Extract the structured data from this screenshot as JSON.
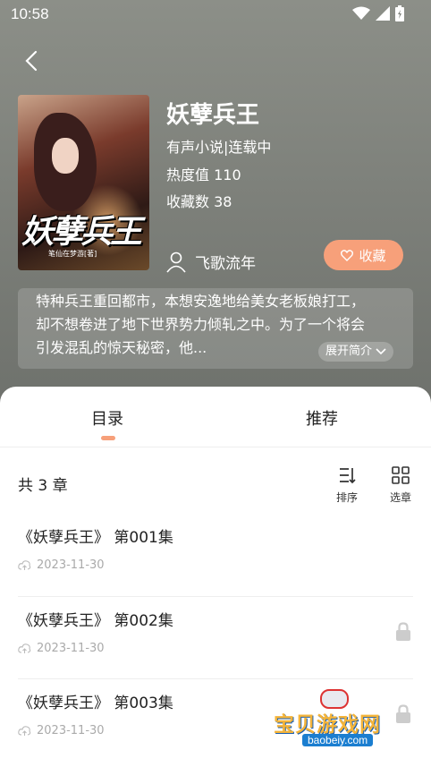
{
  "status_bar": {
    "time": "10:58"
  },
  "book": {
    "title": "妖孽兵王",
    "type_status": "有声小说|连载中",
    "heat": "热度值 110",
    "favorites": "收藏数 38",
    "author": "飞歌流年",
    "favorite_button": "收藏",
    "cover_title": "妖孽兵王",
    "cover_subtitle": "笔仙在梦游[著]"
  },
  "intro": {
    "text_line1": "特种兵王重回都市，本想安逸地给美女老板娘打工，",
    "text_line2": "却不想卷进了地下世界势力倾轧之中。为了一个将会",
    "text_line3": "引发混乱的惊天秘密，他...",
    "expand_label": "展开简介"
  },
  "tabs": [
    {
      "label": "目录",
      "active": true
    },
    {
      "label": "推荐",
      "active": false
    }
  ],
  "catalog": {
    "count_label": "共 3 章",
    "sort_label": "排序",
    "select_label": "选章",
    "chapters": [
      {
        "title": "《妖孽兵王》 第001集",
        "date": "2023-11-30",
        "locked": false
      },
      {
        "title": "《妖孽兵王》 第002集",
        "date": "2023-11-30",
        "locked": true
      },
      {
        "title": "《妖孽兵王》 第003集",
        "date": "2023-11-30",
        "locked": true
      }
    ]
  },
  "watermark": {
    "main": "宝贝游戏网",
    "sub": "baobeiy.com"
  },
  "colors": {
    "accent": "#f7a07a",
    "hero_bg": "#7e817b"
  }
}
